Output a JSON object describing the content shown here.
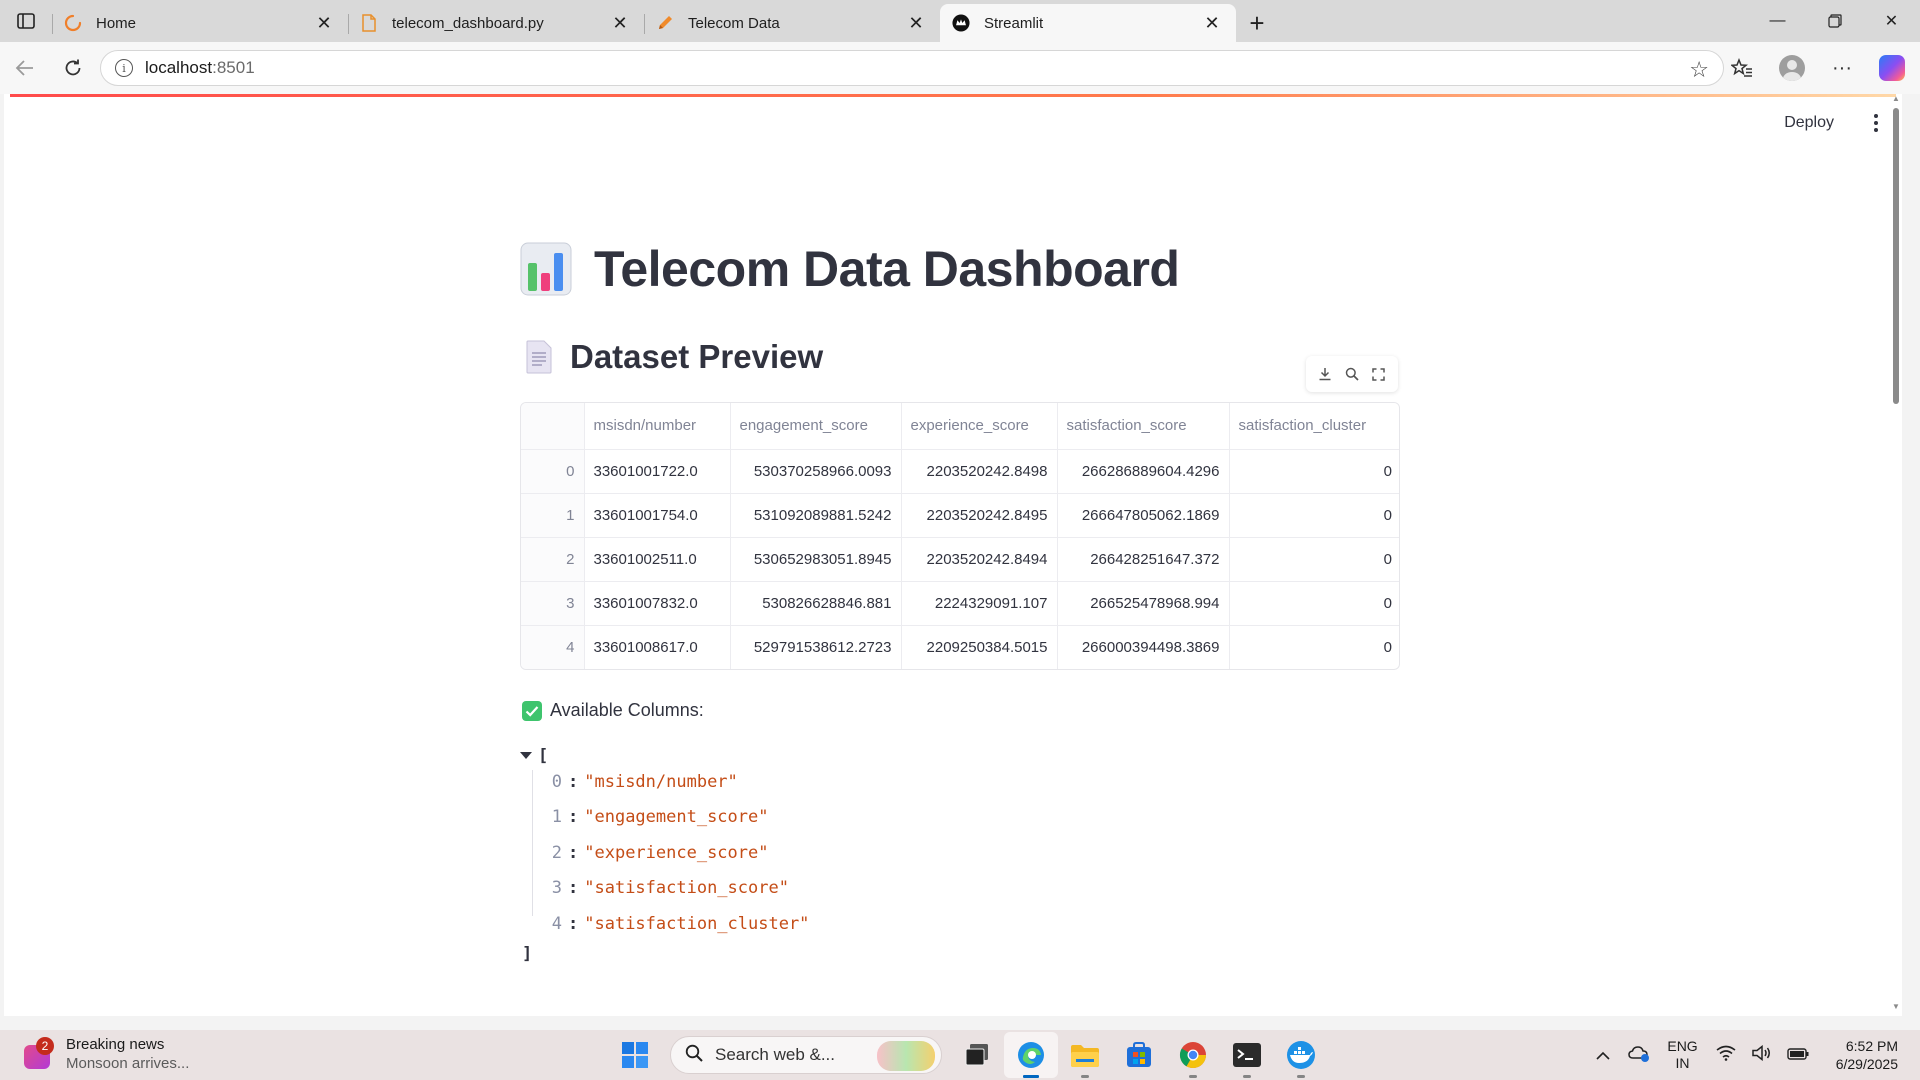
{
  "browser": {
    "tabs": [
      {
        "title": "Home",
        "icon": "loading-spinner-icon"
      },
      {
        "title": "telecom_dashboard.py",
        "icon": "file-icon"
      },
      {
        "title": "Telecom Data",
        "icon": "pen-icon"
      },
      {
        "title": "Streamlit",
        "icon": "streamlit-crown-icon"
      }
    ],
    "active_tab": 3,
    "url_host": "localhost",
    "url_port": ":8501"
  },
  "app": {
    "deploy_label": "Deploy",
    "title": "Telecom Data Dashboard",
    "title_icon": "bar-chart-emoji",
    "subtitle": "Dataset Preview",
    "subtitle_icon": "page-emoji",
    "table": {
      "columns": [
        "msisdn/number",
        "engagement_score",
        "experience_score",
        "satisfaction_score",
        "satisfaction_cluster"
      ],
      "rows": [
        [
          "0",
          "33601001722.0",
          "530370258966.0093",
          "2203520242.8498",
          "266286889604.4296",
          "0"
        ],
        [
          "1",
          "33601001754.0",
          "531092089881.5242",
          "2203520242.8495",
          "266647805062.1869",
          "0"
        ],
        [
          "2",
          "33601002511.0",
          "530652983051.8945",
          "2203520242.8494",
          "266428251647.372",
          "0"
        ],
        [
          "3",
          "33601007832.0",
          "530826628846.881",
          "2224329091.107",
          "266525478968.994",
          "0"
        ],
        [
          "4",
          "33601008617.0",
          "529791538612.2723",
          "2209250384.5015",
          "266000394498.3869",
          "0"
        ]
      ]
    },
    "available_columns_label": "Available Columns:",
    "json_open": "[",
    "json_close": "]",
    "json_items": [
      {
        "index": "0",
        "value": "\"msisdn/number\""
      },
      {
        "index": "1",
        "value": "\"engagement_score\""
      },
      {
        "index": "2",
        "value": "\"experience_score\""
      },
      {
        "index": "3",
        "value": "\"satisfaction_score\""
      },
      {
        "index": "4",
        "value": "\"satisfaction_cluster\""
      }
    ]
  },
  "taskbar": {
    "news_badge": "2",
    "news_title": "Breaking news",
    "news_subtitle": "Monsoon arrives...",
    "search_placeholder": "Search web &...",
    "lang_line1": "ENG",
    "lang_line2": "IN",
    "time": "6:52 PM",
    "date": "6/29/2025"
  },
  "colors": {
    "accent_red": "#ff4b4b",
    "json_string": "#c44d17",
    "checkmark_green": "#3ec46d"
  }
}
